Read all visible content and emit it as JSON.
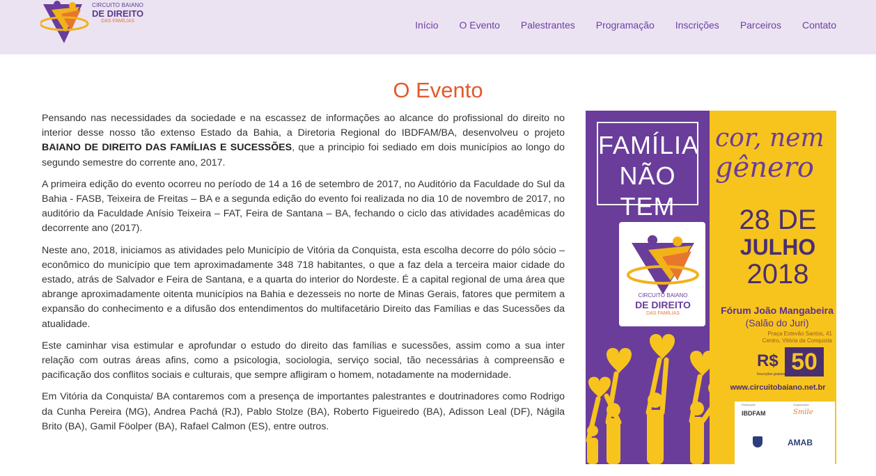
{
  "header": {
    "logo": {
      "line1": "CIRCUITO BAIANO",
      "line2": "DE DIREITO",
      "line3": "DAS FAMÍLIAS"
    },
    "nav": [
      "Início",
      "O Evento",
      "Palestrantes",
      "Programação",
      "Inscrições",
      "Parceiros",
      "Contato"
    ]
  },
  "main": {
    "title": "O Evento",
    "p1_before": "Pensando nas necessidades da sociedade e na escassez de informações ao alcance do profissional do direito no interior desse nosso tão extenso Estado da Bahia, a Diretoria Regional do IBDFAM/BA, desenvolveu o projeto ",
    "p1_bold": "BAIANO DE DIREITO DAS FAMÍLIAS E SUCESSÕES",
    "p1_after": ", que a principio foi sediado em dois municípios ao longo do segundo semestre do corrente ano, 2017.",
    "p2": "A primeira edição do evento ocorreu no período de 14 a 16 de setembro de 2017, no Auditório da Faculdade do Sul da Bahia - FASB, Teixeira de Freitas – BA e a segunda edição do evento foi realizada no dia 10 de novembro de 2017, no auditório da Faculdade Anísio Teixeira – FAT, Feira de Santana – BA, fechando o ciclo das atividades acadêmicas do decorrente ano (2017).",
    "p3": "Neste ano, 2018, iniciamos as atividades pelo Município de Vitória da Conquista, esta escolha decorre do pólo sócio – econômico do município que tem aproximadamente 348 718 habitantes, o que a faz dela a terceira maior cidade do estado, atrás de Salvador e Feira de Santana, e a quarta do interior do Nordeste. É a capital regional de uma área que abrange aproximadamente oitenta municípios na Bahia e dezesseis no norte de Minas Gerais, fatores que permitem a expansão do conhecimento e a difusão dos entendimentos do multifacetário Direito das Famílias e das Sucessões da atualidade.",
    "p4": "Este caminhar visa estimular e aprofundar o estudo do direito das famílias e sucessões, assim como a sua inter relação com outras áreas afins, como a psicologia, sociologia, serviço social, tão necessárias à compreensão e pacificação dos conflitos sociais e culturais, que sempre afligiram o homem, notadamente na modernidade.",
    "p5": "Em Vitória da Conquista/ BA contaremos com a presença de importantes palestrantes e doutrinadores como Rodrigo da Cunha Pereira (MG), Andrea Pachá (RJ), Pablo Stolze (BA), Roberto Figueiredo (BA), Adisson Leal (DF), Nágila Brito (BA), Gamil Föolper (BA), Rafael Calmon (ES), entre outros."
  },
  "poster": {
    "familia_l1": "FAMÍLIA",
    "familia_l2": "NÃO TEM",
    "cor_l1": "cor, nem",
    "cor_l2": "gênero",
    "date_l1": "28 DE",
    "date_l2": "JULHO",
    "date_l3": "2018",
    "forum_l1": "Fórum João Mangabeira",
    "forum_l2": "(Salão do Juri)",
    "addr_l1": "Praça Estevão Santos, 41",
    "addr_l2": "Centro, Vitória da Conquista",
    "currency": "R$",
    "price": "50",
    "price_note": "Inscrições gratuitas",
    "url": "www.circuitobaiano.net.br",
    "label_realizacao": "Realização",
    "label_organizacao": "Organização",
    "ibdfam": "IBDFAM",
    "smile": "Smile",
    "amab": "AMAB",
    "logo_l1": "CIRCUITO BAIANO",
    "logo_l2": "DE DIREITO",
    "logo_l3": "DAS FAMÍLIAS"
  },
  "colors": {
    "header_bg": "#ebe3f2",
    "nav_text": "#6e3fa3",
    "title": "#e25a2e",
    "poster_purple": "#6a3d9a",
    "poster_yellow": "#f7c41e"
  }
}
